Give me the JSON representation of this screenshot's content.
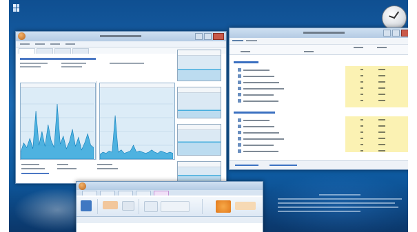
{
  "screen": {
    "caption": ""
  },
  "resource_monitor": {
    "title": "",
    "menu_items": [
      "",
      "",
      "",
      ""
    ],
    "tabs": [
      "",
      "",
      "",
      ""
    ],
    "active_tab_index": 0,
    "overview_heading": "",
    "cpu_graph_label": "",
    "cpu_usage_series": [
      6,
      14,
      10,
      18,
      9,
      42,
      12,
      24,
      11,
      30,
      16,
      10,
      48,
      13,
      20,
      9,
      15,
      26,
      11,
      19,
      8,
      14,
      22,
      12,
      10
    ],
    "memory_graph_label": "",
    "memory_usage_series": [
      4,
      6,
      5,
      7,
      6,
      38,
      6,
      8,
      5,
      6,
      7,
      12,
      6,
      7,
      6,
      5,
      6,
      8,
      6,
      5,
      7,
      6,
      5,
      6,
      5
    ],
    "side_graphs": [
      {
        "label": "",
        "level_percent": 45
      },
      {
        "label": "",
        "level_percent": 30
      },
      {
        "label": "",
        "level_percent": 52
      },
      {
        "label": "",
        "level_percent": 40
      }
    ]
  },
  "task_window": {
    "title": "",
    "tabs": [
      "",
      ""
    ],
    "columns": [
      "",
      "",
      "",
      ""
    ],
    "apps_section_label": "",
    "app_rows": [
      {
        "name": "",
        "values": [
          "",
          ""
        ]
      },
      {
        "name": "",
        "values": [
          "",
          ""
        ]
      },
      {
        "name": "",
        "values": [
          "",
          ""
        ]
      },
      {
        "name": "",
        "values": [
          "",
          ""
        ]
      },
      {
        "name": "",
        "values": [
          "",
          ""
        ]
      },
      {
        "name": "",
        "values": [
          "",
          ""
        ]
      }
    ],
    "background_section_label": "",
    "background_rows": [
      {
        "name": "",
        "values": [
          "",
          ""
        ]
      },
      {
        "name": "",
        "values": [
          "",
          ""
        ]
      },
      {
        "name": "",
        "values": [
          "",
          ""
        ]
      },
      {
        "name": "",
        "values": [
          "",
          ""
        ]
      },
      {
        "name": "",
        "values": [
          "",
          ""
        ]
      },
      {
        "name": "",
        "values": [
          "",
          ""
        ]
      }
    ],
    "fewer_details_label": "",
    "end_task_label": ""
  },
  "ribbon_app": {
    "tabs": [
      "",
      "",
      "",
      "",
      ""
    ],
    "highlighted_tab_index": 4
  },
  "colors": {
    "desktop_blue": "#1d6cb6",
    "accent_blue": "#4b78c4",
    "graph_fill": "#dcecf7",
    "graph_line": "#1f9fd8",
    "highlight_yellow": "#fbf2b3",
    "close_red": "#c95a4a"
  },
  "icons": [
    "windows-orb-icon",
    "clock-gadget-icon",
    "app-icon",
    "close-icon",
    "maximize-icon",
    "minimize-icon"
  ]
}
